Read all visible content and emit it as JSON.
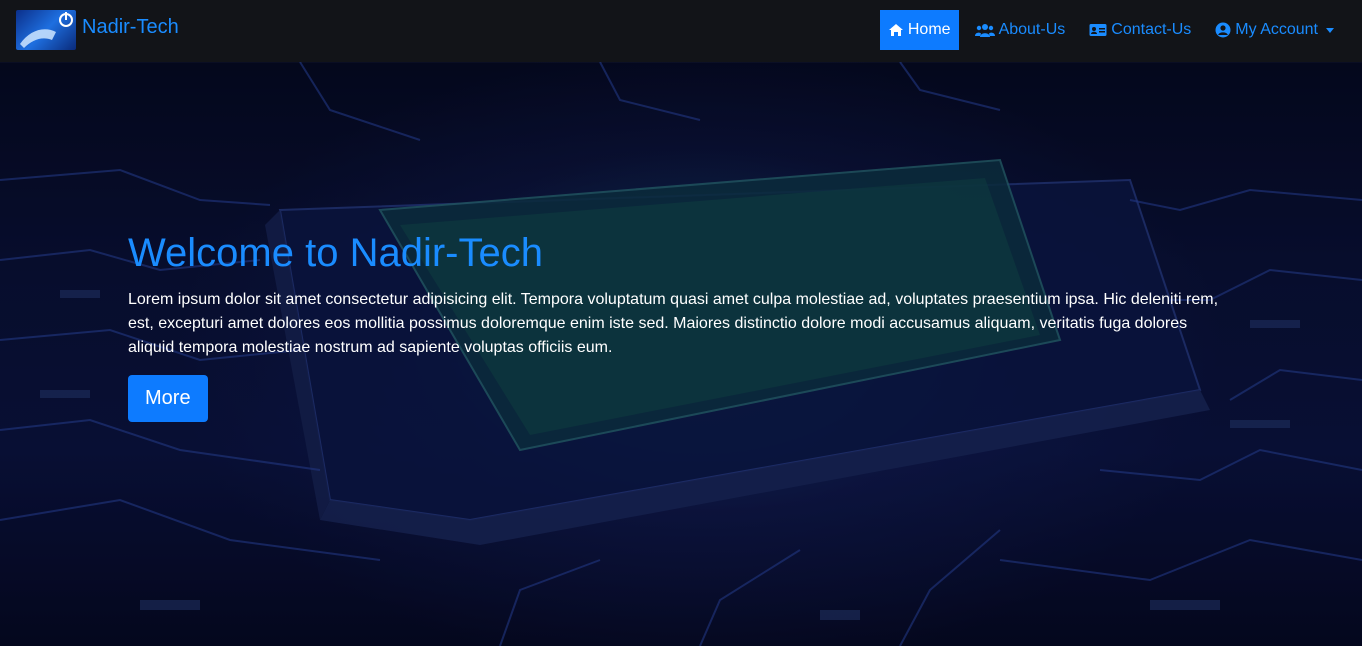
{
  "brand": {
    "name": "Nadir-Tech",
    "logo_icon": "power-hand-logo"
  },
  "nav": {
    "items": [
      {
        "label": "Home",
        "icon": "home-icon",
        "active": true
      },
      {
        "label": "About-Us",
        "icon": "users-icon",
        "active": false
      },
      {
        "label": "Contact-Us",
        "icon": "address-card-icon",
        "active": false
      },
      {
        "label": "My Account",
        "icon": "user-circle-icon",
        "active": false,
        "dropdown": true
      }
    ]
  },
  "hero": {
    "title": "Welcome to Nadir-Tech",
    "text": "Lorem ipsum dolor sit amet consectetur adipisicing elit. Tempora voluptatum quasi amet culpa molestiae ad, voluptates praesentium ipsa. Hic deleniti rem, est, excepturi amet dolores eos mollitia possimus doloremque enim iste sed. Maiores distinctio dolore modi accusamus aliquam, veritatis fuga dolores aliquid tempora molestiae nostrum ad sapiente voluptas officiis eum.",
    "button_label": "More"
  },
  "colors": {
    "accent": "#0d7bff",
    "link": "#1a8cff",
    "navbar_bg": "#121418"
  }
}
